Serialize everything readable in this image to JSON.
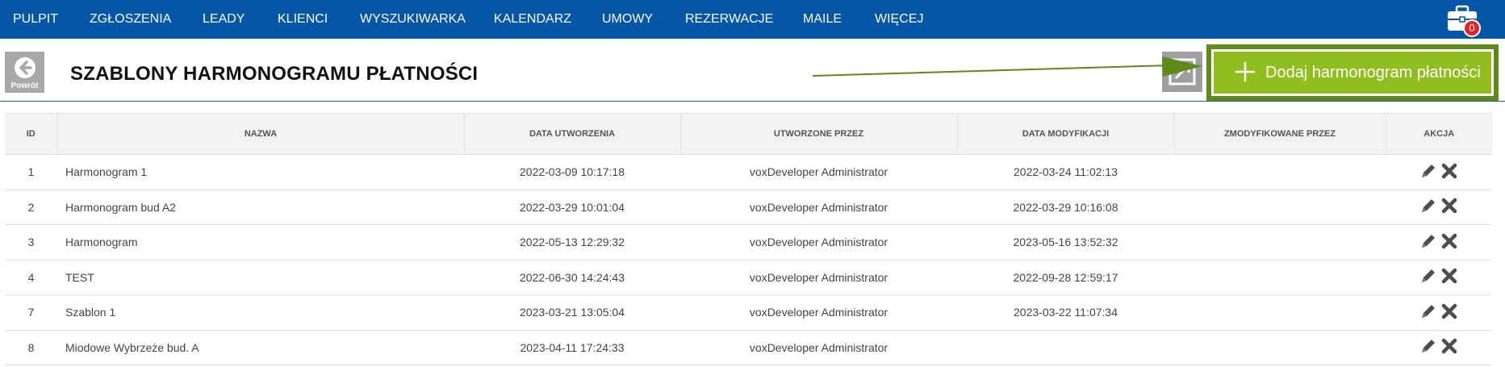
{
  "nav": {
    "items": [
      "PULPIT",
      "ZGŁOSZENIA",
      "LEADY",
      "KLIENCI",
      "WYSZUKIWARKA",
      "KALENDARZ",
      "UMOWY",
      "REZERWACJE",
      "MAILE",
      "WIĘCEJ"
    ],
    "notification_count": "0",
    "icon": "toolbox-icon"
  },
  "header": {
    "back_label": "Powrót",
    "title": "SZABLONY HARMONOGRAMU PŁATNOŚCI",
    "add_button_label": "Dodaj harmonogram płatności"
  },
  "colors": {
    "nav_bg": "#0555a8",
    "add_button": "#8fbe1e",
    "highlight": "#5f8a1a"
  },
  "table": {
    "columns": [
      "ID",
      "NAZWA",
      "DATA UTWORZENIA",
      "UTWORZONE PRZEZ",
      "DATA MODYFIKACJI",
      "ZMODYFIKOWANE PRZEZ",
      "AKCJA"
    ],
    "rows": [
      {
        "id": "1",
        "name": "Harmonogram 1",
        "created": "2022-03-09 10:17:18",
        "created_by": "voxDeveloper Administrator",
        "modified": "2022-03-24 11:02:13",
        "modified_by": ""
      },
      {
        "id": "2",
        "name": "Harmonogram bud A2",
        "created": "2022-03-29 10:01:04",
        "created_by": "voxDeveloper Administrator",
        "modified": "2022-03-29 10:16:08",
        "modified_by": ""
      },
      {
        "id": "3",
        "name": "Harmonogram",
        "created": "2022-05-13 12:29:32",
        "created_by": "voxDeveloper Administrator",
        "modified": "2023-05-16 13:52:32",
        "modified_by": ""
      },
      {
        "id": "4",
        "name": "TEST",
        "created": "2022-06-30 14:24:43",
        "created_by": "voxDeveloper Administrator",
        "modified": "2022-09-28 12:59:17",
        "modified_by": ""
      },
      {
        "id": "7",
        "name": "Szablon 1",
        "created": "2023-03-21 13:05:04",
        "created_by": "voxDeveloper Administrator",
        "modified": "2023-03-22 11:07:34",
        "modified_by": ""
      },
      {
        "id": "8",
        "name": "Miodowe Wybrzeże bud. A",
        "created": "2023-04-11 17:24:33",
        "created_by": "voxDeveloper Administrator",
        "modified": "",
        "modified_by": ""
      }
    ]
  }
}
